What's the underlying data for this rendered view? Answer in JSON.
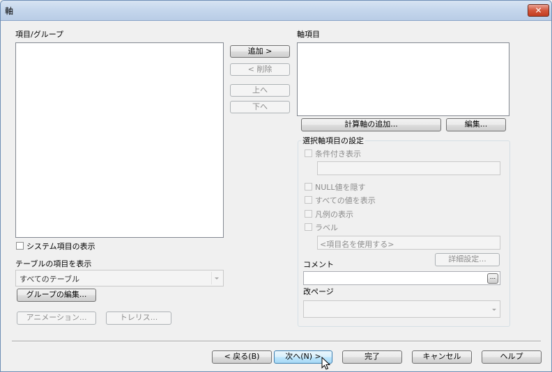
{
  "window": {
    "title": "軸",
    "close_label": "✕"
  },
  "left": {
    "items_label": "項目/グループ",
    "show_system_label": "システム項目の表示",
    "table_items_label": "テーブルの項目を表示",
    "table_select_value": "すべてのテーブル",
    "edit_groups_label": "グループの編集...",
    "animation_label": "アニメーション...",
    "trellis_label": "トレリス..."
  },
  "middle": {
    "add_label": "追加 >",
    "remove_label": "< 削除",
    "up_label": "上へ",
    "down_label": "下へ"
  },
  "right": {
    "axis_items_label": "軸項目",
    "add_calc_label": "計算軸の追加...",
    "edit_label": "編集...",
    "settings_group_label": "選択軸項目の設定",
    "conditional_label": "条件付き表示",
    "hide_null_label": "NULL値を隠す",
    "show_all_label": "すべての値を表示",
    "legend_label": "凡例の表示",
    "label_label": "ラベル",
    "label_placeholder": "<項目名を使用する>",
    "detail_settings_label": "詳細設定...",
    "comment_label": "コメント",
    "comment_browse_label": "...",
    "page_break_label": "改ページ"
  },
  "footer": {
    "back_label": "< 戻る(B)",
    "next_label": "次へ(N) >",
    "finish_label": "完了",
    "cancel_label": "キャンセル",
    "help_label": "ヘルプ"
  }
}
